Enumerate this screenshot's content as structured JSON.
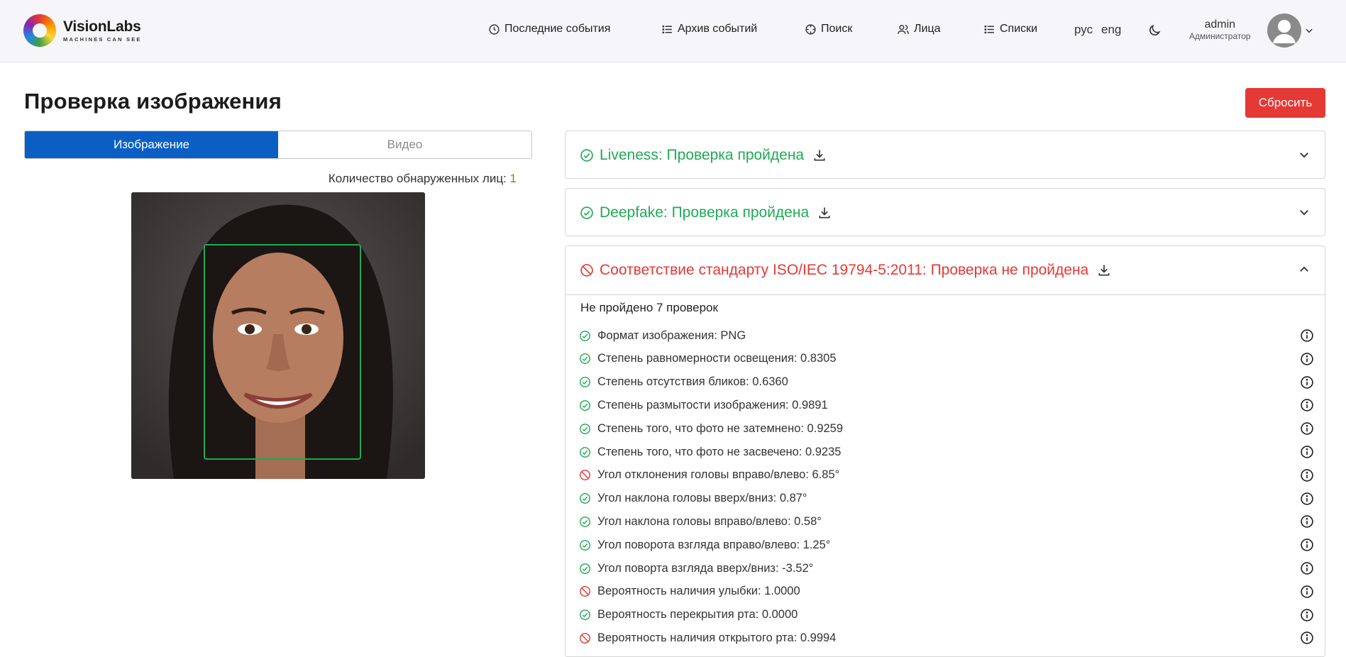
{
  "header": {
    "logo_name": "VisionLabs",
    "logo_tagline": "MACHINES CAN SEE",
    "nav": [
      {
        "label": "Последние события",
        "icon": "clock-icon"
      },
      {
        "label": "Архив событий",
        "icon": "list-icon"
      },
      {
        "label": "Поиск",
        "icon": "crosshair-icon"
      },
      {
        "label": "Лица",
        "icon": "users-icon"
      },
      {
        "label": "Списки",
        "icon": "list-icon"
      }
    ],
    "lang_ru": "рус",
    "lang_en": "eng",
    "user_name": "admin",
    "user_role": "Администратор"
  },
  "page": {
    "title": "Проверка изображения",
    "reset_label": "Сбросить",
    "tab_image": "Изображение",
    "tab_video": "Видео",
    "face_count_label": "Количество обнаруженных лиц:",
    "face_count_value": "1"
  },
  "panels": {
    "liveness": {
      "title": "Liveness: Проверка пройдена",
      "status": "pass"
    },
    "deepfake": {
      "title": "Deepfake: Проверка пройдена",
      "status": "pass"
    },
    "iso": {
      "title": "Соответствие стандарту ISO/IEC 19794-5:2011: Проверка не пройдена",
      "status": "fail"
    }
  },
  "iso_summary": "Не пройдено 7 проверок",
  "checks": [
    {
      "label": "Формат изображения: PNG",
      "status": "pass"
    },
    {
      "label": "Степень равномерности освещения: 0.8305",
      "status": "pass"
    },
    {
      "label": "Степень отсутствия бликов: 0.6360",
      "status": "pass"
    },
    {
      "label": "Степень размытости изображения: 0.9891",
      "status": "pass"
    },
    {
      "label": "Степень того, что фото не затемнено: 0.9259",
      "status": "pass"
    },
    {
      "label": "Степень того, что фото не засвечено: 0.9235",
      "status": "pass"
    },
    {
      "label": "Угол отклонения головы вправо/влево: 6.85°",
      "status": "fail"
    },
    {
      "label": "Угол наклона головы вверх/вниз: 0.87°",
      "status": "pass"
    },
    {
      "label": "Угол наклона головы вправо/влево: 0.58°",
      "status": "pass"
    },
    {
      "label": "Угол поворота взгляда вправо/влево: 1.25°",
      "status": "pass"
    },
    {
      "label": "Угол поворта взгляда вверх/вниз: -3.52°",
      "status": "pass"
    },
    {
      "label": "Вероятность наличия улыбки: 1.0000",
      "status": "fail"
    },
    {
      "label": "Вероятность перекрытия рта: 0.0000",
      "status": "pass"
    },
    {
      "label": "Вероятность наличия открытого рта: 0.9994",
      "status": "fail"
    }
  ],
  "colors": {
    "pass": "#1faa55",
    "fail": "#e53935",
    "accent": "#0b5fc4"
  }
}
